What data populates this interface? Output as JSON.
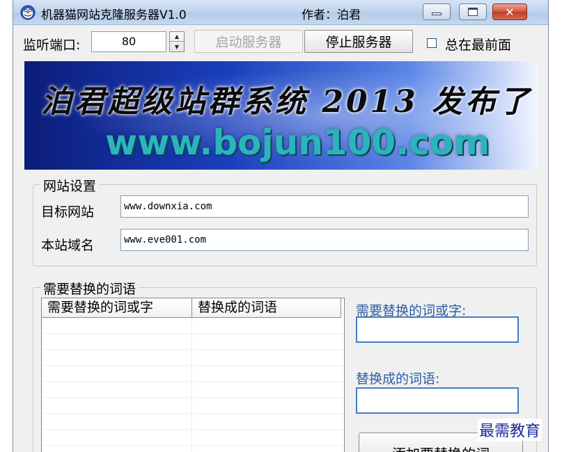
{
  "window": {
    "title": "机器猫网站克隆服务器V1.0",
    "author": "作者：泊君"
  },
  "toolbar": {
    "port_label": "监听端口:",
    "port_value": "80",
    "start_button": "启动服务器",
    "stop_button": "停止服务器",
    "always_on_top_label": "总在最前面",
    "always_on_top_checked": false
  },
  "banner": {
    "headline": "泊君超级站群系统 2013 发布了",
    "url": "www.bojun100.com"
  },
  "site_settings": {
    "legend": "网站设置",
    "target_label": "目标网站",
    "target_value": "www.downxia.com",
    "domain_label": "本站域名",
    "domain_value": "www.eve001.com"
  },
  "replace_words": {
    "legend": "需要替换的词语",
    "columns": [
      "需要替换的词或字",
      "替换成的词语"
    ],
    "rows": [],
    "find_label": "需要替换的词或字:",
    "find_value": "",
    "replace_label": "替换成的词语:",
    "replace_value": "",
    "add_button": "添加要替换的词"
  },
  "watermark": "最需教育",
  "colors": {
    "accent_label": "#2c5ea8",
    "input_focus_border": "#3f7ec7",
    "banner_url": "#2bb4bd"
  }
}
